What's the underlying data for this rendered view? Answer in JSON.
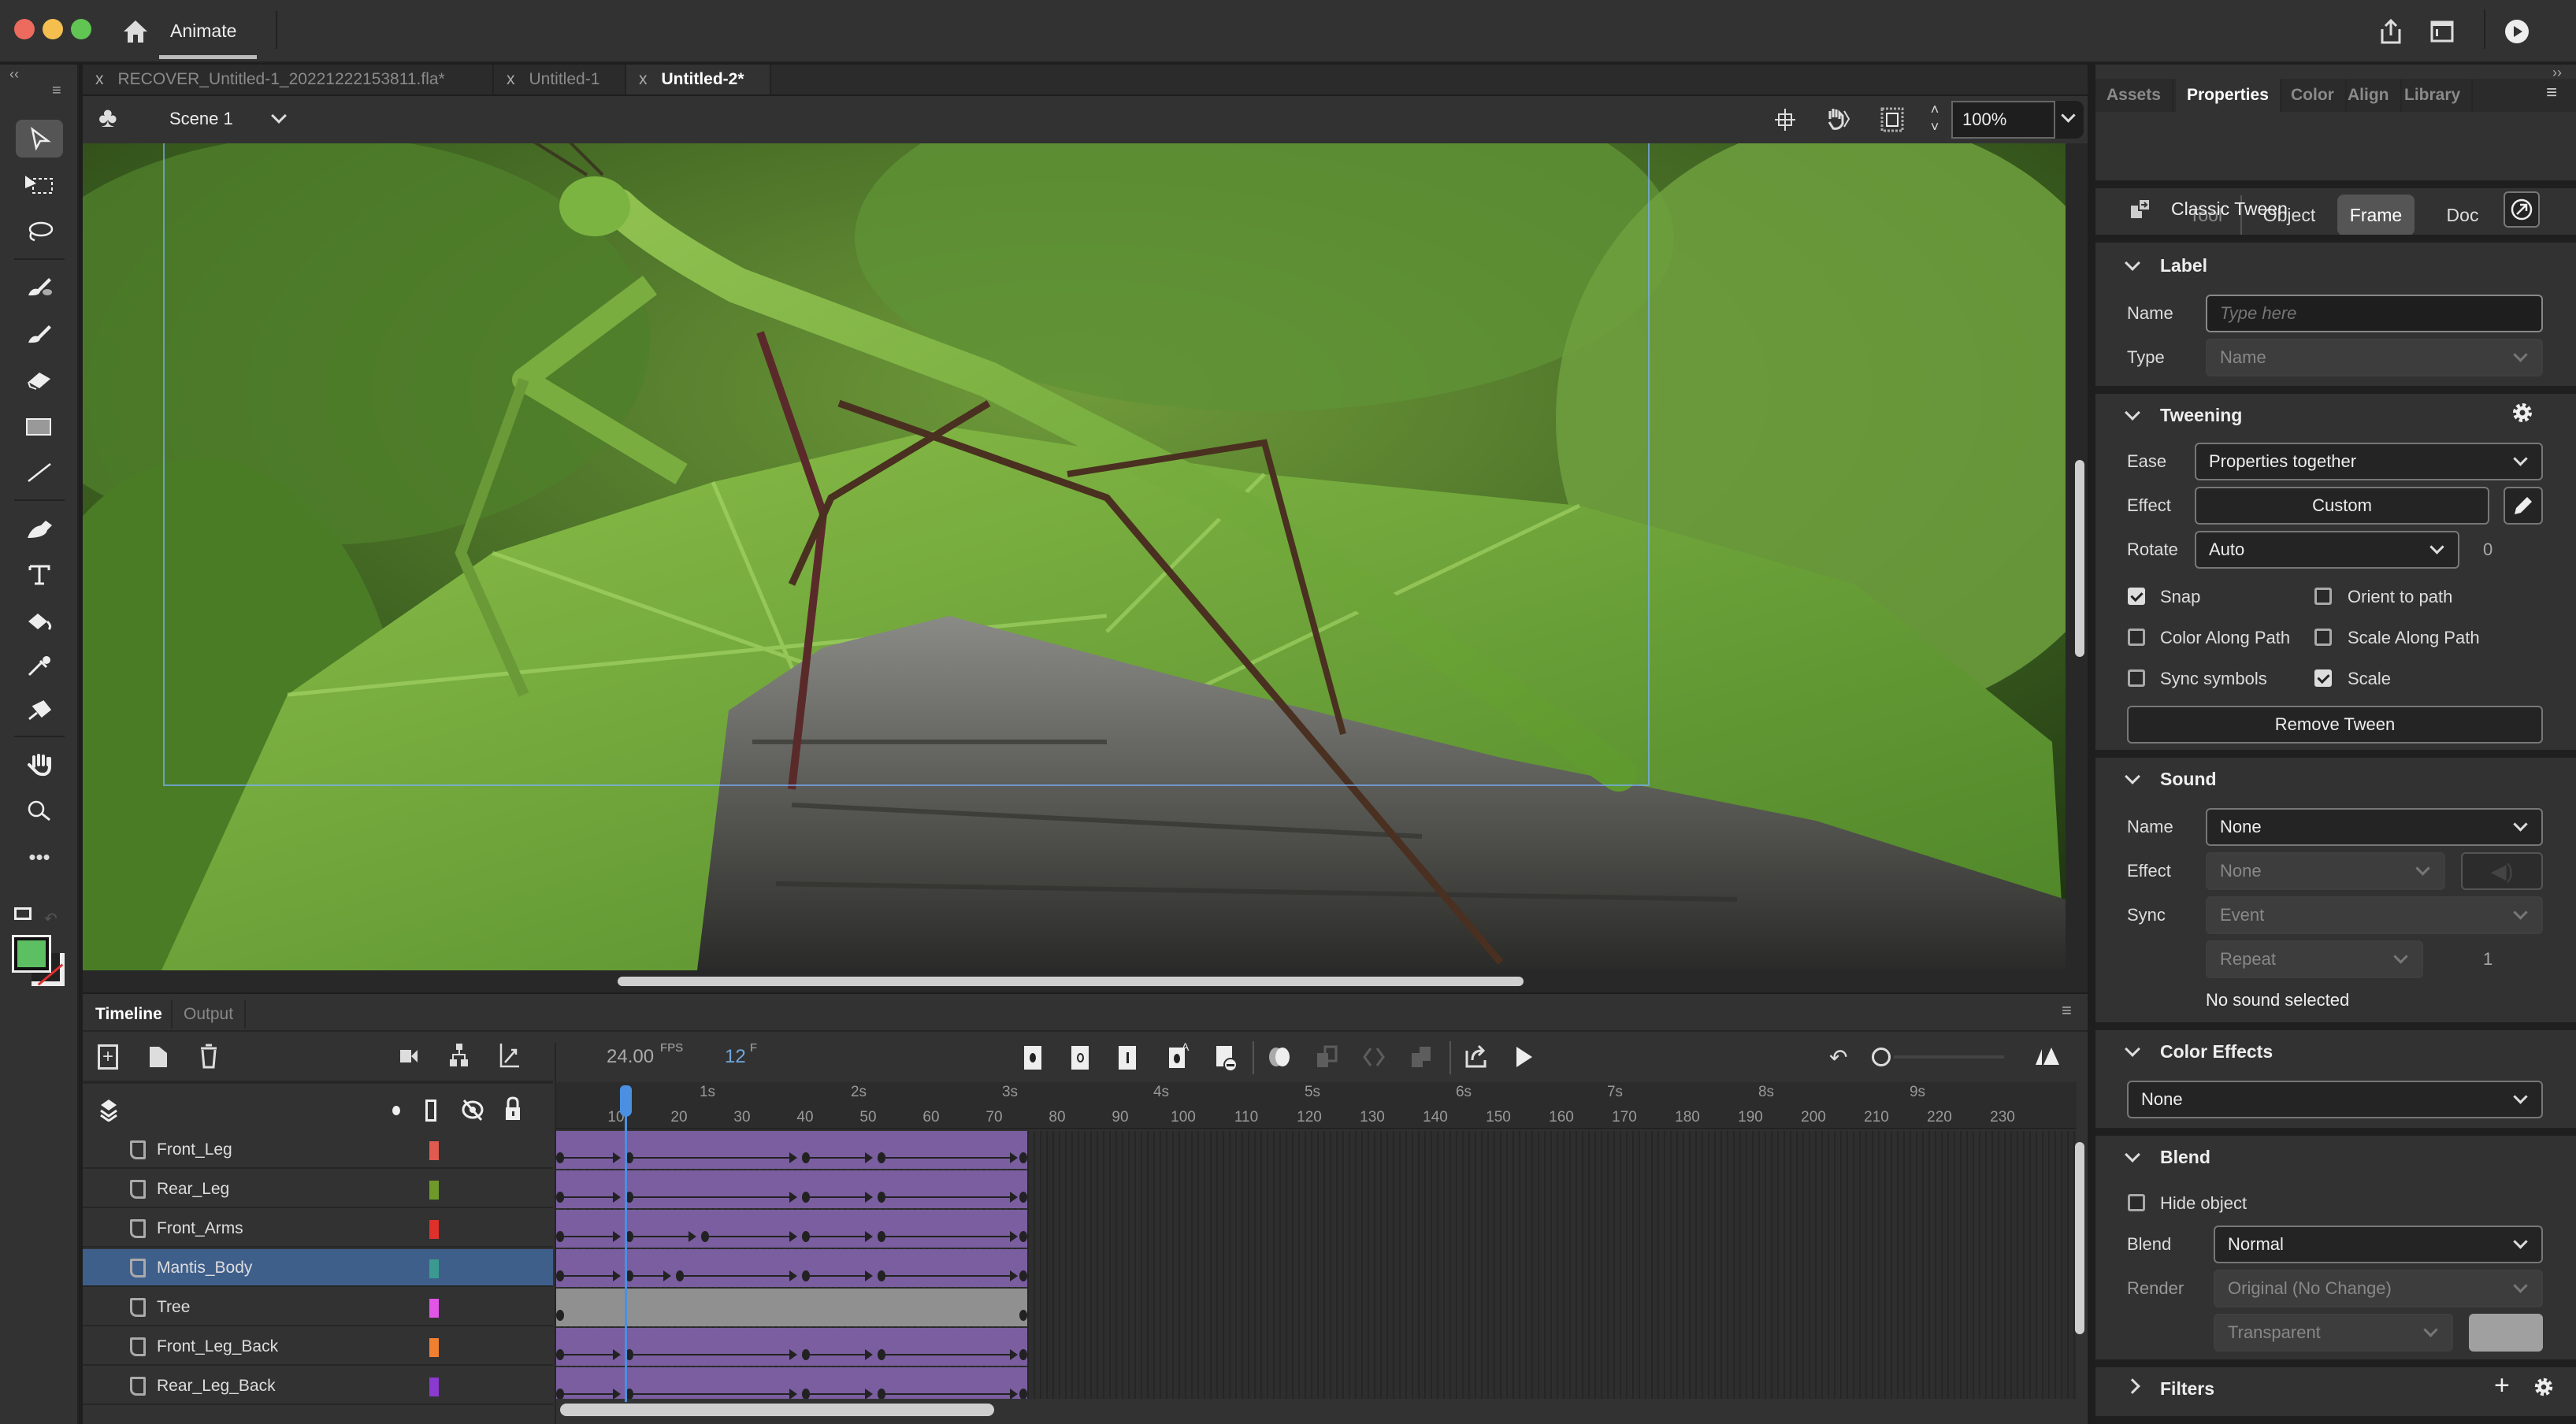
{
  "app": {
    "title": "Animate"
  },
  "title_icons": [
    "home-icon",
    "share-icon",
    "workspace-icon",
    "test-movie-icon"
  ],
  "doc_tabs": [
    {
      "label": "RECOVER_Untitled-1_20221222153811.fla*",
      "active": false
    },
    {
      "label": "Untitled-1",
      "active": false
    },
    {
      "label": "Untitled-2*",
      "active": true
    }
  ],
  "scene": {
    "label": "Scene 1",
    "zoom": "100%"
  },
  "tools": [
    "selection",
    "subselection",
    "lasso",
    "paint-brush",
    "brush",
    "eraser",
    "rectangle",
    "line",
    "pen",
    "text",
    "paint-bucket",
    "eyedropper",
    "pin",
    "hand",
    "zoom",
    "more"
  ],
  "colors": {
    "fill": "#5cbf62",
    "stroke": "#ffffff",
    "tween": "#7a5ea0",
    "playhead": "#4a8fe0",
    "frame_indicator": "#6fa8dc",
    "selected_layer": "#3f5f8b"
  },
  "timeline": {
    "tabs": [
      {
        "label": "Timeline",
        "active": true
      },
      {
        "label": "Output",
        "active": false
      }
    ],
    "fps": "24.00",
    "fps_unit": "FPS",
    "current_frame": "12",
    "frame_unit": "F",
    "ruler_numbers": [
      "10",
      "20",
      "30",
      "40",
      "50",
      "60",
      "70",
      "80",
      "90",
      "100",
      "110",
      "120",
      "130",
      "140",
      "150",
      "160",
      "170",
      "180",
      "190",
      "200",
      "210",
      "220",
      "230"
    ],
    "ruler_seconds": [
      "1s",
      "2s",
      "3s",
      "4s",
      "5s",
      "6s",
      "7s",
      "8s",
      "9s"
    ],
    "layers": [
      {
        "name": "Front_Leg",
        "color": "#e05a4f",
        "keyframes": [
          1,
          12,
          40,
          52,
          75
        ],
        "type": "tween"
      },
      {
        "name": "Rear_Leg",
        "color": "#6f9a2a",
        "keyframes": [
          1,
          12,
          40,
          52,
          75
        ],
        "type": "tween"
      },
      {
        "name": "Front_Arms",
        "color": "#e0302a",
        "keyframes": [
          1,
          12,
          24,
          40,
          52,
          75
        ],
        "type": "tween"
      },
      {
        "name": "Mantis_Body",
        "color": "#3a9a90",
        "keyframes": [
          1,
          12,
          20,
          40,
          52,
          75
        ],
        "type": "tween",
        "selected": true
      },
      {
        "name": "Tree",
        "color": "#e255e6",
        "keyframes": [
          1,
          75
        ],
        "type": "static"
      },
      {
        "name": "Front_Leg_Back",
        "color": "#f08030",
        "keyframes": [
          1,
          12,
          40,
          52,
          75
        ],
        "type": "tween"
      },
      {
        "name": "Rear_Leg_Back",
        "color": "#8a3ad0",
        "keyframes": [
          1,
          12,
          40,
          52,
          75
        ],
        "type": "tween"
      }
    ]
  },
  "panel": {
    "tabs": [
      {
        "label": "Assets",
        "active": false
      },
      {
        "label": "Properties",
        "active": true
      },
      {
        "label": "Color",
        "active": false
      },
      {
        "label": "Align",
        "active": false
      },
      {
        "label": "Library",
        "active": false
      }
    ],
    "segments": [
      {
        "label": "Tool",
        "active": false
      },
      {
        "label": "Object",
        "active": false
      },
      {
        "label": "Frame",
        "active": true
      },
      {
        "label": "Doc",
        "active": false
      }
    ],
    "tween_type": "Classic Tween",
    "label_section": {
      "title": "Label",
      "name_label": "Name",
      "name_placeholder": "Type here",
      "type_label": "Type",
      "type_value": "Name"
    },
    "tweening": {
      "title": "Tweening",
      "ease_label": "Ease",
      "ease_value": "Properties together",
      "effect_label": "Effect",
      "effect_value": "Custom",
      "rotate_label": "Rotate",
      "rotate_value": "Auto",
      "rotate_count": "0",
      "checkboxes": [
        {
          "label": "Snap",
          "checked": true
        },
        {
          "label": "Orient to path",
          "checked": false
        },
        {
          "label": "Color Along Path",
          "checked": false
        },
        {
          "label": "Scale Along Path",
          "checked": false
        },
        {
          "label": "Sync symbols",
          "checked": false
        },
        {
          "label": "Scale",
          "checked": true
        }
      ],
      "remove_label": "Remove Tween"
    },
    "sound": {
      "title": "Sound",
      "name_label": "Name",
      "name_value": "None",
      "effect_label": "Effect",
      "effect_value": "None",
      "sync_label": "Sync",
      "sync_value": "Event",
      "repeat_value": "Repeat",
      "repeat_count": "1",
      "status": "No sound selected"
    },
    "color_effects": {
      "title": "Color Effects",
      "value": "None"
    },
    "blend": {
      "title": "Blend",
      "hide_label": "Hide object",
      "hide_checked": false,
      "blend_label": "Blend",
      "blend_value": "Normal",
      "render_label": "Render",
      "render_value": "Original (No Change)",
      "background_value": "Transparent"
    },
    "filters": {
      "title": "Filters"
    }
  }
}
